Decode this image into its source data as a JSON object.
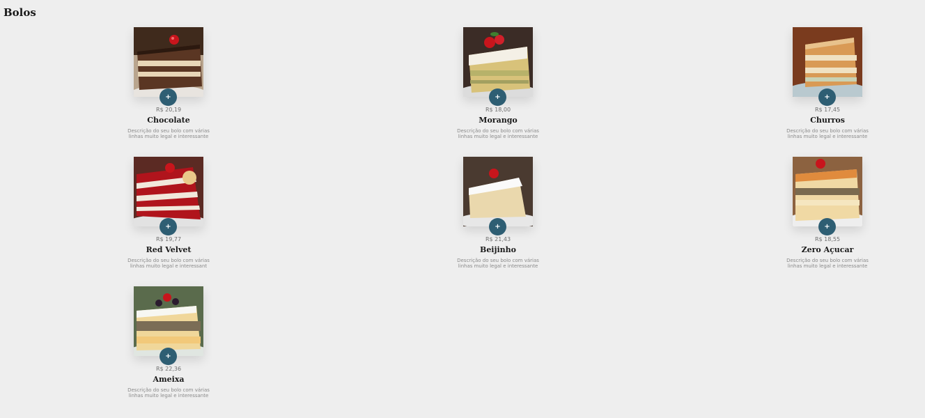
{
  "section": {
    "title": "Bolos"
  },
  "products": [
    {
      "price": "R$ 20,19",
      "name": "Chocolate",
      "description": "Descrição do seu bolo com várias linhas muito legal e interessante",
      "image": "chocolate-cake-slice",
      "add_label": "+"
    },
    {
      "price": "R$ 18,00",
      "name": "Morango",
      "description": "Descrição do seu bolo com várias linhas muito legal e interessante",
      "image": "strawberry-cake-slice",
      "add_label": "+"
    },
    {
      "price": "R$ 17,45",
      "name": "Churros",
      "description": "Descrição do seu bolo com várias linhas muito legal e interessante",
      "image": "churros-cake-slice",
      "add_label": "+"
    },
    {
      "price": "R$ 19,77",
      "name": "Red Velvet",
      "description": "Descrição do seu bolo com várias linhas muito legal e interessant",
      "image": "red-velvet-cake-slice",
      "add_label": "+"
    },
    {
      "price": "R$ 21,43",
      "name": "Beijinho",
      "description": "Descrição do seu bolo com várias linhas muito legal e interessante",
      "image": "beijinho-cake-slice",
      "add_label": "+"
    },
    {
      "price": "R$ 18,55",
      "name": "Zero Açucar",
      "description": "Descrição do seu bolo com várias linhas muito legal e interessante",
      "image": "sugar-free-cake-slice",
      "add_label": "+"
    },
    {
      "price": "R$ 22,36",
      "name": "Ameixa",
      "description": "Descrição do seu bolo com várias linhas muito legal e interessante",
      "image": "plum-cake-slice",
      "add_label": "+"
    }
  ],
  "colors": {
    "background": "#eeeeee",
    "button": "#2e5e73",
    "title": "#1a1a1a",
    "price": "#6e6e6e",
    "description": "#8a8a8a"
  }
}
